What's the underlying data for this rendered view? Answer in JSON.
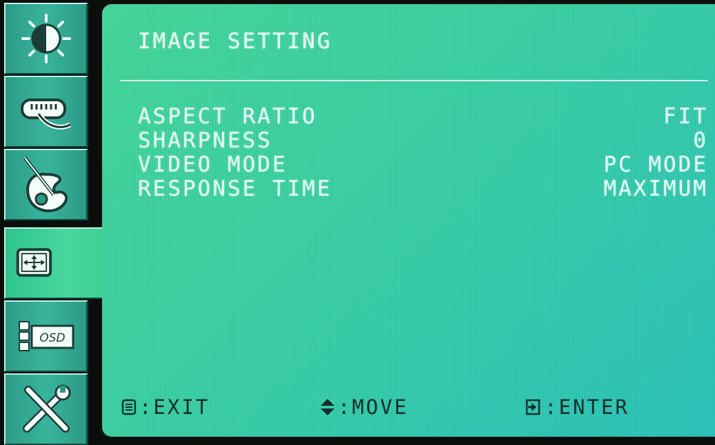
{
  "title": "IMAGE SETTING",
  "sidebar": {
    "items": [
      {
        "icon": "brightness-icon",
        "active": false
      },
      {
        "icon": "video-input-icon",
        "active": false
      },
      {
        "icon": "color-palette-icon",
        "active": false
      },
      {
        "icon": "image-setting-icon",
        "active": true
      },
      {
        "icon": "osd-icon",
        "active": false,
        "label": "OSD"
      },
      {
        "icon": "tools-icon",
        "active": false
      }
    ]
  },
  "settings": [
    {
      "label": "ASPECT RATIO",
      "value": "FIT"
    },
    {
      "label": "SHARPNESS",
      "value": "0"
    },
    {
      "label": "VIDEO MODE",
      "value": "PC MODE"
    },
    {
      "label": "RESPONSE TIME",
      "value": "MAXIMUM"
    }
  ],
  "footer": {
    "exit": ":EXIT",
    "move": ":MOVE",
    "enter": ":ENTER"
  },
  "colors": {
    "panel_start": "#46d69a",
    "panel_end": "#2cc3bb",
    "sidebar": "#2c9a86",
    "sidebar_active": "#3ecf95",
    "text": "#e3fff4",
    "footer_text": "#0d2e2a"
  }
}
